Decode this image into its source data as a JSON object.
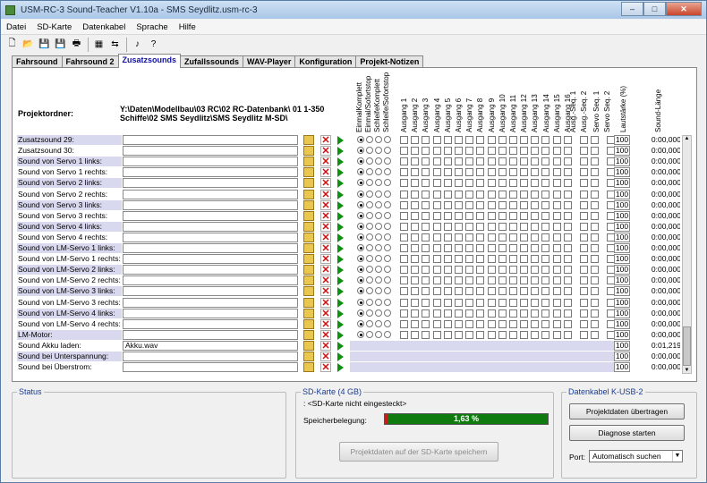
{
  "window": {
    "title": "USM-RC-3 Sound-Teacher V1.10a - SMS Seydlitz.usm-rc-3",
    "min": "–",
    "max": "□",
    "close": "✕"
  },
  "menu": [
    "Datei",
    "SD-Karte",
    "Datenkabel",
    "Sprache",
    "Hilfe"
  ],
  "toolbar": [
    {
      "icon": "new-file-icon",
      "glyph": "🗋"
    },
    {
      "icon": "open-folder-icon",
      "glyph": "📂"
    },
    {
      "icon": "save-icon",
      "glyph": "💾"
    },
    {
      "icon": "save-as-icon",
      "glyph": "💾"
    },
    {
      "icon": "print-icon",
      "glyph": "🖶"
    },
    {
      "icon": "sep"
    },
    {
      "icon": "sd-card-icon",
      "glyph": "▦"
    },
    {
      "icon": "usb-cable-icon",
      "glyph": "⇆"
    },
    {
      "icon": "sep"
    },
    {
      "icon": "music-note-icon",
      "glyph": "♪"
    },
    {
      "icon": "help-book-icon",
      "glyph": "?"
    }
  ],
  "tabs": [
    {
      "label": "Fahrsound",
      "active": false
    },
    {
      "label": "Fahrsound 2",
      "active": false
    },
    {
      "label": "Zusatzsounds",
      "active": true
    },
    {
      "label": "Zufallssounds",
      "active": false
    },
    {
      "label": "WAV-Player",
      "active": false
    },
    {
      "label": "Konfiguration",
      "active": false
    },
    {
      "label": "Projekt-Notizen",
      "active": false
    }
  ],
  "project": {
    "label": "Projektordner:",
    "path": "Y:\\Daten\\Modellbau\\03 RC\\02 RC-Datenbank\\ 01 1-350 Schiffe\\02 SMS Seydlitz\\SMS Seydlitz M-SD\\"
  },
  "headers": {
    "modes": [
      "EinmalKomplett",
      "Einmal/Sofortstop",
      "SchleifeKomplett",
      "Schleife/Sofortstop"
    ],
    "outputs": [
      "Ausgang 1",
      "Ausgang 2",
      "Ausgang 3",
      "Ausgang 4",
      "Ausgang 5",
      "Ausgang 6",
      "Ausgang 7",
      "Ausgang 8",
      "Ausgang 9",
      "Ausgang 10",
      "Ausgang 11",
      "Ausgang 12",
      "Ausgang 13",
      "Ausgang 14",
      "Ausgang 15",
      "Ausgang 16"
    ],
    "seq": [
      "Ausg.-Seq. 1",
      "Ausg.-Seq. 2"
    ],
    "servo": [
      "Servo Seq. 1",
      "Servo Seq. 2"
    ],
    "volume": "Lautstärke (%)",
    "length": "Sound-Länge"
  },
  "rows": [
    {
      "label": "Zusatzsound 29:",
      "file": "",
      "vol": "100",
      "len": "0:00,000",
      "hide": false
    },
    {
      "label": "Zusatzsound 30:",
      "file": "",
      "vol": "100",
      "len": "0:00,000",
      "hide": false
    },
    {
      "label": "Sound von Servo 1 links:",
      "file": "",
      "vol": "100",
      "len": "0:00,000",
      "hide": false
    },
    {
      "label": "Sound von Servo 1 rechts:",
      "file": "",
      "vol": "100",
      "len": "0:00,000",
      "hide": false
    },
    {
      "label": "Sound von Servo 2 links:",
      "file": "",
      "vol": "100",
      "len": "0:00,000",
      "hide": false
    },
    {
      "label": "Sound von Servo 2 rechts:",
      "file": "",
      "vol": "100",
      "len": "0:00,000",
      "hide": false
    },
    {
      "label": "Sound von Servo 3 links:",
      "file": "",
      "vol": "100",
      "len": "0:00,000",
      "hide": false
    },
    {
      "label": "Sound von Servo 3 rechts:",
      "file": "",
      "vol": "100",
      "len": "0:00,000",
      "hide": false
    },
    {
      "label": "Sound von Servo 4 links:",
      "file": "",
      "vol": "100",
      "len": "0:00,000",
      "hide": false
    },
    {
      "label": "Sound von Servo 4 rechts:",
      "file": "",
      "vol": "100",
      "len": "0:00,000",
      "hide": false
    },
    {
      "label": "Sound von LM-Servo 1 links:",
      "file": "",
      "vol": "100",
      "len": "0:00,000",
      "hide": false
    },
    {
      "label": "Sound von LM-Servo 1 rechts:",
      "file": "",
      "vol": "100",
      "len": "0:00,000",
      "hide": false
    },
    {
      "label": "Sound von LM-Servo 2 links:",
      "file": "",
      "vol": "100",
      "len": "0:00,000",
      "hide": false
    },
    {
      "label": "Sound von LM-Servo 2 rechts:",
      "file": "",
      "vol": "100",
      "len": "0:00,000",
      "hide": false
    },
    {
      "label": "Sound von LM-Servo 3 links:",
      "file": "",
      "vol": "100",
      "len": "0:00,000",
      "hide": false
    },
    {
      "label": "Sound von LM-Servo 3 rechts:",
      "file": "",
      "vol": "100",
      "len": "0:00,000",
      "hide": false
    },
    {
      "label": "Sound von LM-Servo 4 links:",
      "file": "",
      "vol": "100",
      "len": "0:00,000",
      "hide": false
    },
    {
      "label": "Sound von LM-Servo 4 rechts:",
      "file": "",
      "vol": "100",
      "len": "0:00,000",
      "hide": false
    },
    {
      "label": "LM-Motor:",
      "file": "",
      "vol": "100",
      "len": "0:00,000",
      "hide": false
    },
    {
      "label": "Sound Akku laden:",
      "file": "Akku.wav",
      "vol": "100",
      "len": "0:01,219",
      "hide": true
    },
    {
      "label": "Sound bei Unterspannung:",
      "file": "",
      "vol": "100",
      "len": "0:00,000",
      "hide": true
    },
    {
      "label": "Sound bei Überstrom:",
      "file": "",
      "vol": "100",
      "len": "0:00,000",
      "hide": true
    }
  ],
  "status": {
    "title": "Status"
  },
  "sd": {
    "title": "SD-Karte (4 GB)",
    "info": ": <SD-Karte nicht eingesteckt>",
    "usage_label": "Speicherbelegung:",
    "usage_value": "1,63 %",
    "usage_fraction": 0.0163,
    "save_button": "Projektdaten auf der SD-Karte speichern"
  },
  "cable": {
    "title": "Datenkabel K-USB-2",
    "transfer_button": "Projektdaten übertragen",
    "diag_button": "Diagnose starten",
    "port_label": "Port:",
    "port_value": "Automatisch suchen"
  },
  "colors": {
    "progress": "#0f7b0f",
    "row_alt": "#d8d8ee"
  }
}
